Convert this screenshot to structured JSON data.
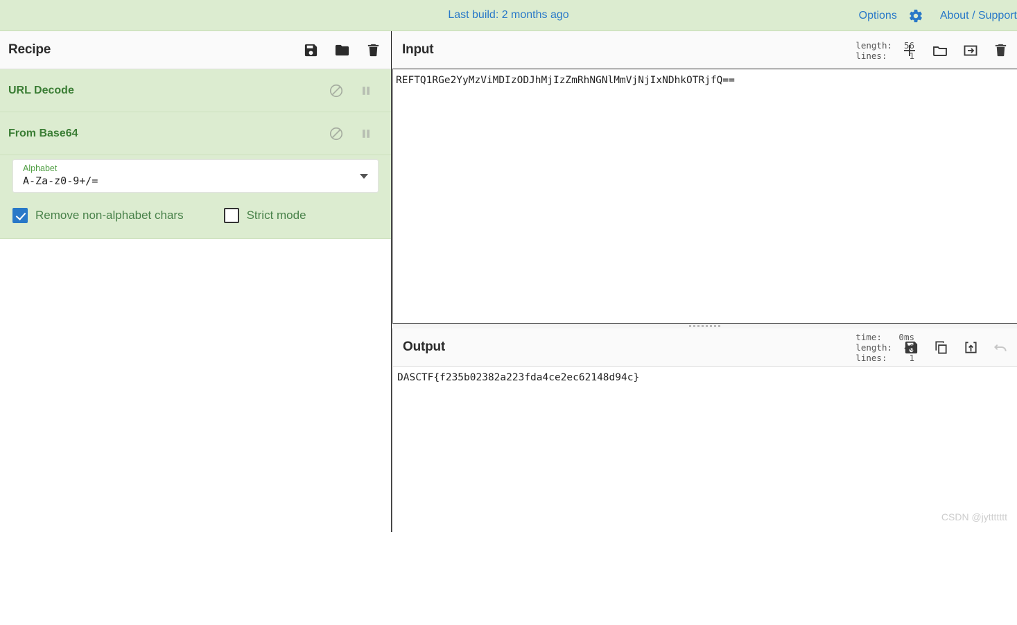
{
  "banner": {
    "build_text": "Last build: 2 months ago",
    "options_label": "Options",
    "about_label": "About / Support",
    "gear_icon": "gear-icon",
    "link_color": "#2878c8",
    "background": "#dcecd0"
  },
  "recipe": {
    "title": "Recipe",
    "icons": [
      "save-icon",
      "folder-icon",
      "trash-icon"
    ],
    "operations": [
      {
        "name": "URL Decode",
        "disable_icon": "disable-icon",
        "pause_icon": "breakpoint-pause-icon",
        "args": []
      },
      {
        "name": "From Base64",
        "disable_icon": "disable-icon",
        "pause_icon": "breakpoint-pause-icon",
        "args": [
          {
            "type": "select",
            "label": "Alphabet",
            "value": "A-Za-z0-9+/=",
            "caret_icon": "chevron-down-icon"
          },
          {
            "type": "checkbox",
            "label": "Remove non-alphabet chars",
            "checked": true
          },
          {
            "type": "checkbox",
            "label": "Strict mode",
            "checked": false
          }
        ]
      }
    ],
    "op_text_color": "#3a7d34",
    "op_background": "#dcecd0"
  },
  "input": {
    "title": "Input",
    "meta": [
      {
        "key": "length:",
        "value": "56"
      },
      {
        "key": "lines:",
        "value": "1"
      }
    ],
    "text": "REFTQ1RGe2YyMzViMDIzODJhMjIzZmRhNGNlMmVjNjIxNDhkOTRjfQ==",
    "icons": [
      "add-tab-icon",
      "open-folder-icon",
      "open-folder-as-input-icon",
      "clear-io-icon"
    ]
  },
  "output": {
    "title": "Output",
    "meta": [
      {
        "key": "time:",
        "value": "0ms"
      },
      {
        "key": "length:",
        "value": "40"
      },
      {
        "key": "lines:",
        "value": "1"
      }
    ],
    "text": "DASCTF{f235b02382a223fda4ce2ec62148d94c}",
    "icons": [
      "save-output-icon",
      "copy-output-icon",
      "replace-input-icon",
      "undo-icon"
    ]
  },
  "watermark": "CSDN @jyttttttt"
}
